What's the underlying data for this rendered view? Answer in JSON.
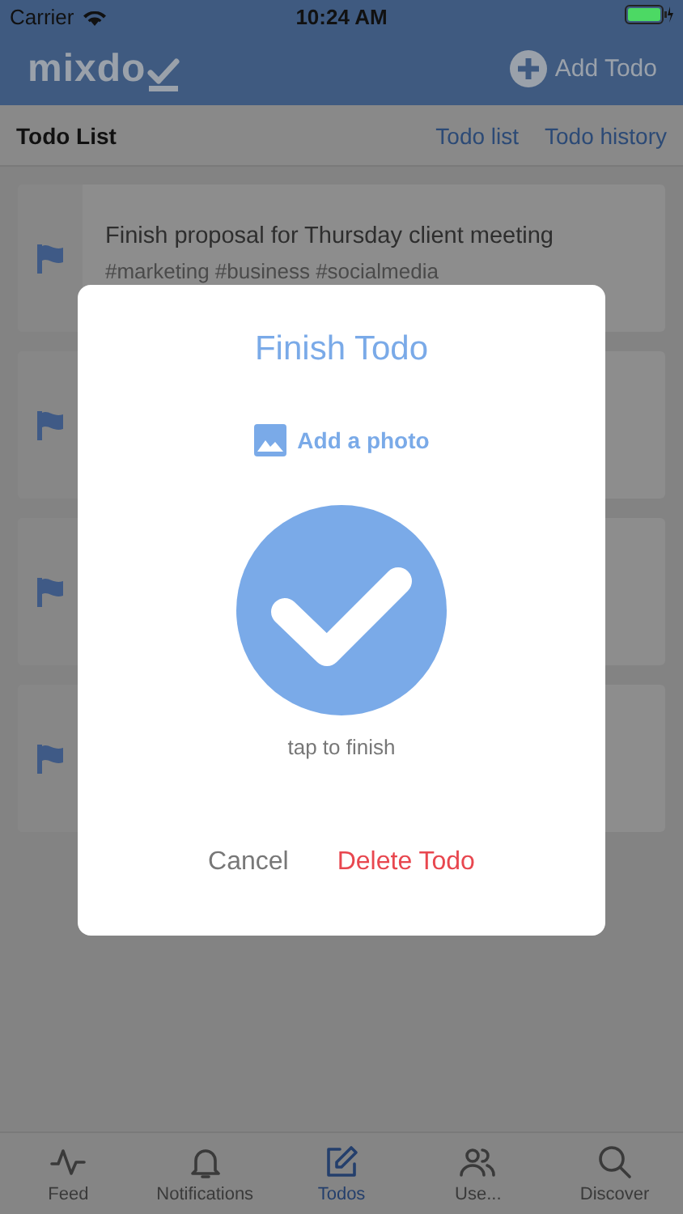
{
  "status_bar": {
    "carrier": "Carrier",
    "time": "10:24 AM"
  },
  "header": {
    "logo": "mixdo",
    "add_button": "Add Todo"
  },
  "subnav": {
    "title": "Todo List",
    "links": [
      "Todo list",
      "Todo history"
    ]
  },
  "todos": [
    {
      "flagged": true,
      "title": "Finish proposal for Thursday client meeting",
      "tags": "#marketing #business #socialmedia"
    },
    {
      "flagged": true
    },
    {
      "flagged": true
    },
    {
      "flagged": true
    }
  ],
  "dialog": {
    "title": "Finish Todo",
    "add_photo": "Add a photo",
    "hint": "tap to finish",
    "buttons": [
      {
        "label": "Cancel",
        "kind": "cancel"
      },
      {
        "label": "Delete Todo",
        "kind": "destructive"
      }
    ]
  },
  "tab_bar": [
    {
      "label": "Feed",
      "selected": false
    },
    {
      "label": "Notifications",
      "selected": false
    },
    {
      "label": "Todos",
      "selected": true
    },
    {
      "label": "Use...",
      "selected": false
    },
    {
      "label": "Discover",
      "selected": false
    }
  ]
}
